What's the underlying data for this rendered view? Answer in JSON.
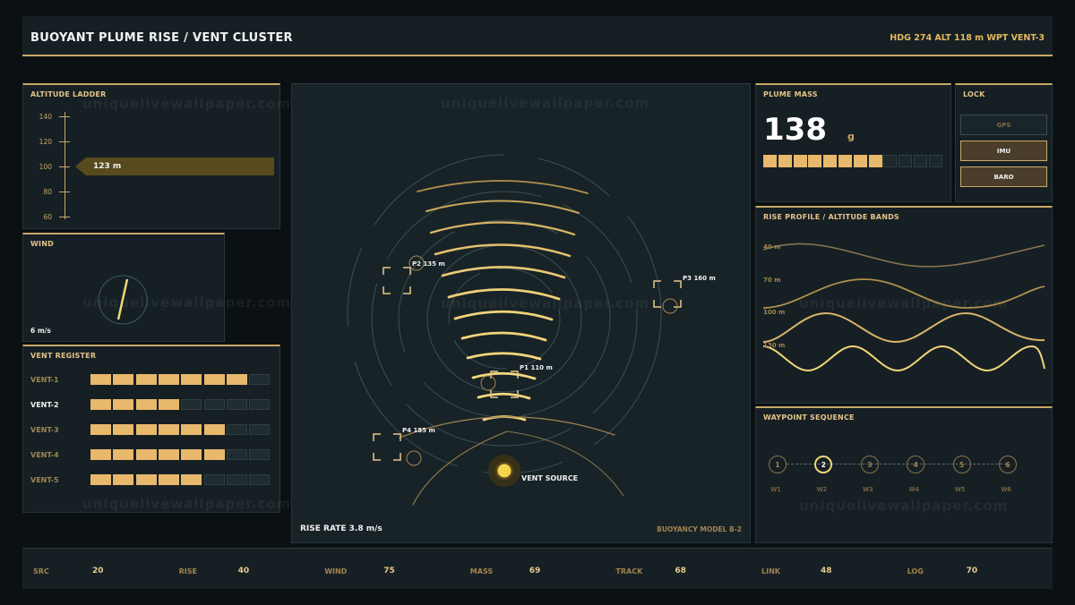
{
  "header": {
    "title": "BUOYANT PLUME RISE / VENT CLUSTER",
    "readout": "HDG 274  ALT 118 m  WPT VENT-3"
  },
  "watermark": "uniquelivewallpaper.com",
  "altitude": {
    "title": "ALTITUDE LADDER",
    "ticks": [
      "140",
      "120",
      "100",
      "80",
      "60"
    ],
    "current": "123 m"
  },
  "wind": {
    "title": "WIND",
    "speed": "6 m/s"
  },
  "vents": {
    "title": "VENT REGISTER",
    "rows": [
      {
        "name": "VENT-1",
        "level": 7,
        "selected": false
      },
      {
        "name": "VENT-2",
        "level": 4,
        "selected": true
      },
      {
        "name": "VENT-3",
        "level": 6,
        "selected": false
      },
      {
        "name": "VENT-4",
        "level": 6,
        "selected": false
      },
      {
        "name": "VENT-5",
        "level": 5,
        "selected": false
      }
    ],
    "segments": 8
  },
  "main": {
    "points": [
      {
        "label": "P1 110 m"
      },
      {
        "label": "P2 135 m"
      },
      {
        "label": "P3 160 m"
      },
      {
        "label": "P4 185 m"
      }
    ],
    "source_label": "VENT SOURCE",
    "rise_rate": "RISE RATE 3.8 m/s",
    "model": "BUOYANCY MODEL B-2"
  },
  "mass": {
    "title": "PLUME MASS",
    "value": "138",
    "unit": "g",
    "level": 8,
    "segments": 12
  },
  "lock": {
    "title": "LOCK",
    "items": [
      {
        "label": "GPS",
        "active": false
      },
      {
        "label": "IMU",
        "active": true
      },
      {
        "label": "BARO",
        "active": true
      }
    ]
  },
  "profile": {
    "title": "RISE PROFILE / ALTITUDE BANDS",
    "bands": [
      "40 m",
      "70 m",
      "100 m",
      "130 m"
    ]
  },
  "waypoints": {
    "title": "WAYPOINT SEQUENCE",
    "items": [
      {
        "num": "1",
        "label": "W1",
        "active": false
      },
      {
        "num": "2",
        "label": "W2",
        "active": true
      },
      {
        "num": "3",
        "label": "W3",
        "active": false
      },
      {
        "num": "4",
        "label": "W4",
        "active": false
      },
      {
        "num": "5",
        "label": "W5",
        "active": false
      },
      {
        "num": "6",
        "label": "W6",
        "active": false
      }
    ]
  },
  "footer": [
    {
      "label": "SRC",
      "value": "20"
    },
    {
      "label": "RISE",
      "value": "40"
    },
    {
      "label": "WIND",
      "value": "75"
    },
    {
      "label": "MASS",
      "value": "69"
    },
    {
      "label": "TRACK",
      "value": "68"
    },
    {
      "label": "LINK",
      "value": "48"
    },
    {
      "label": "LOG",
      "value": "70"
    }
  ],
  "colors": {
    "accent": "#c9a86a",
    "gold": "#e8b86c",
    "bright": "#f2d47a",
    "background": "#0b1013",
    "panel": "#162024"
  }
}
